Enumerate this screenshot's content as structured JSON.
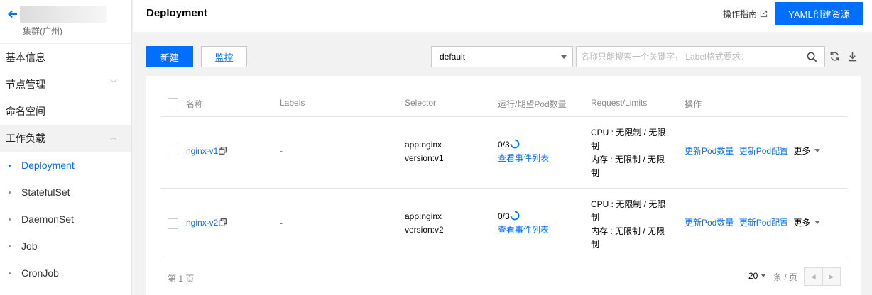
{
  "sidebar": {
    "cluster_sub": "集群(广州)",
    "items": [
      {
        "label": "基本信息"
      },
      {
        "label": "节点管理",
        "chevron": "chevron-down-icon"
      },
      {
        "label": "命名空间"
      },
      {
        "label": "工作负载",
        "chevron": "chevron-up-icon"
      }
    ],
    "sub_items": [
      {
        "label": "Deployment",
        "active": true
      },
      {
        "label": "StatefulSet"
      },
      {
        "label": "DaemonSet"
      },
      {
        "label": "Job"
      },
      {
        "label": "CronJob"
      }
    ]
  },
  "header": {
    "title": "Deployment",
    "guide_label": "操作指南",
    "yaml_button": "YAML创建资源"
  },
  "toolbar": {
    "new_button": "新建",
    "monitor_button": "监控",
    "namespace": "default",
    "search_placeholder": "名称只能搜索一个关键字， Label格式要求："
  },
  "table": {
    "headers": [
      "名称",
      "Labels",
      "Selector",
      "运行/期望Pod数量",
      "Request/Limits",
      "操作"
    ],
    "rows": [
      {
        "name": "nginx-v1",
        "labels": "-",
        "selector": [
          "app:nginx",
          "version:v1"
        ],
        "pods": "0/3",
        "events_link": "查看事件列表",
        "limits": [
          "CPU : 无限制 / 无限",
          "制",
          "内存 : 无限制 / 无限",
          "制"
        ],
        "actions": {
          "update_count": "更新Pod数量",
          "update_config": "更新Pod配置",
          "more": "更多"
        }
      },
      {
        "name": "nginx-v2",
        "labels": "-",
        "selector": [
          "app:nginx",
          "version:v2"
        ],
        "pods": "0/3",
        "events_link": "查看事件列表",
        "limits": [
          "CPU : 无限制 / 无限",
          "制",
          "内存 : 无限制 / 无限",
          "制"
        ],
        "actions": {
          "update_count": "更新Pod数量",
          "update_config": "更新Pod配置",
          "more": "更多"
        }
      }
    ]
  },
  "pagination": {
    "page_info": "第 1 页",
    "page_size": "20",
    "page_size_unit": "条 / 页"
  },
  "colors": {
    "accent": "#006eff"
  }
}
